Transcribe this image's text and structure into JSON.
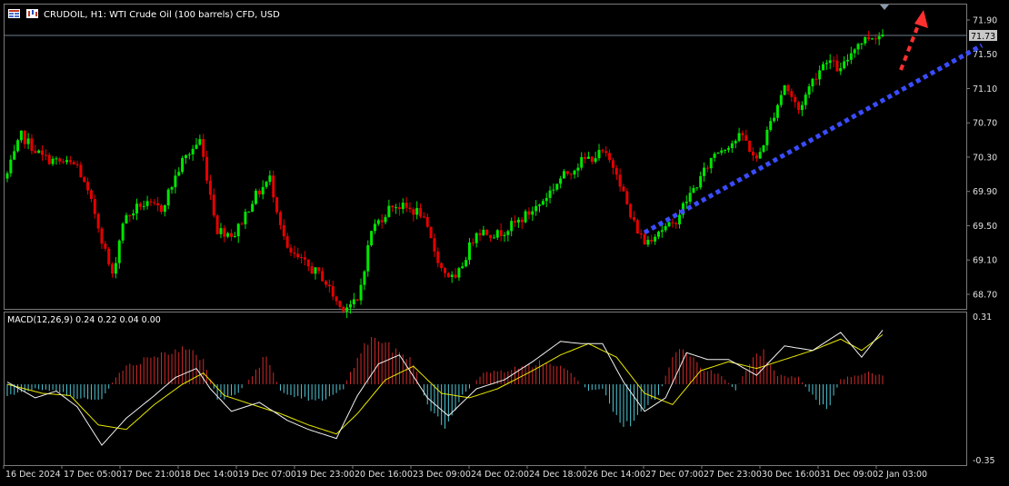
{
  "header": {
    "symbol_line": "CRUDOIL, H1:  WTI Crude Oil (100 barrels) CFD, USD"
  },
  "macd": {
    "label": "MACD(12,26,9) 0.24 0.22 0.04 0.00",
    "top_label": "0.31",
    "bottom_label": "-0.35"
  },
  "price_axis": {
    "ticks": [
      "71.90",
      "71.50",
      "71.10",
      "70.70",
      "70.30",
      "69.90",
      "69.50",
      "69.10",
      "68.70"
    ],
    "current_price_label": "71.73"
  },
  "time_axis": {
    "labels": [
      "16 Dec 2024",
      "17 Dec 05:00",
      "17 Dec 21:00",
      "18 Dec 14:00",
      "19 Dec 07:00",
      "19 Dec 23:00",
      "20 Dec 16:00",
      "23 Dec 09:00",
      "24 Dec 02:00",
      "24 Dec 18:00",
      "26 Dec 14:00",
      "27 Dec 07:00",
      "27 Dec 23:00",
      "30 Dec 16:00",
      "31 Dec 09:00",
      "2 Jan 03:00"
    ]
  },
  "colors": {
    "background": "#000000",
    "bull": "#00e600",
    "bear": "#e60000",
    "macd_pos": "#d02a2a",
    "macd_neg": "#4fc7d6",
    "macd_line": "#f2f2f2",
    "signal_line": "#e8e800",
    "trendline": "#3a4cff",
    "forecast_arrow": "#ff3030",
    "axis_text": "#e0e0e0",
    "frame": "#7a7a7a"
  },
  "icons": [
    "grid-icon",
    "chart-type-icon"
  ],
  "chart_data": [
    {
      "type": "candlestick",
      "axis": "right",
      "ylim": [
        68.53,
        72.08
      ],
      "grid": false,
      "anchors": [
        [
          0,
          70.1
        ],
        [
          4,
          70.55
        ],
        [
          10,
          70.3
        ],
        [
          14,
          70.25
        ],
        [
          20,
          70.2
        ],
        [
          25,
          69.65
        ],
        [
          30,
          68.9
        ],
        [
          33,
          69.55
        ],
        [
          38,
          69.75
        ],
        [
          44,
          69.7
        ],
        [
          50,
          70.25
        ],
        [
          55,
          70.5
        ],
        [
          60,
          69.45
        ],
        [
          65,
          69.4
        ],
        [
          70,
          69.8
        ],
        [
          75,
          70.05
        ],
        [
          80,
          69.2
        ],
        [
          85,
          69.05
        ],
        [
          90,
          68.9
        ],
        [
          95,
          68.55
        ],
        [
          100,
          68.6
        ],
        [
          104,
          69.45
        ],
        [
          110,
          69.75
        ],
        [
          118,
          69.65
        ],
        [
          124,
          69.0
        ],
        [
          128,
          68.85
        ],
        [
          134,
          69.45
        ],
        [
          140,
          69.4
        ],
        [
          146,
          69.55
        ],
        [
          152,
          69.75
        ],
        [
          158,
          70.05
        ],
        [
          164,
          70.25
        ],
        [
          170,
          70.35
        ],
        [
          174,
          70.15
        ],
        [
          178,
          69.6
        ],
        [
          182,
          69.3
        ],
        [
          186,
          69.45
        ],
        [
          190,
          69.5
        ],
        [
          194,
          69.8
        ],
        [
          198,
          70.05
        ],
        [
          202,
          70.35
        ],
        [
          206,
          70.45
        ],
        [
          210,
          70.55
        ],
        [
          214,
          70.25
        ],
        [
          218,
          70.7
        ],
        [
          222,
          71.15
        ],
        [
          226,
          70.85
        ],
        [
          230,
          71.2
        ],
        [
          234,
          71.45
        ],
        [
          238,
          71.3
        ],
        [
          242,
          71.6
        ],
        [
          246,
          71.7
        ],
        [
          250,
          71.73
        ]
      ]
    },
    {
      "type": "bar+line",
      "name": "MACD(12,26,9)",
      "ylim": [
        -0.35,
        0.31
      ],
      "histogram_anchors": [
        [
          0,
          -0.05
        ],
        [
          8,
          -0.02
        ],
        [
          14,
          -0.03
        ],
        [
          20,
          -0.06
        ],
        [
          27,
          -0.07
        ],
        [
          32,
          0.06
        ],
        [
          40,
          0.12
        ],
        [
          45,
          0.15
        ],
        [
          50,
          0.15
        ],
        [
          56,
          0.12
        ],
        [
          60,
          -0.07
        ],
        [
          66,
          -0.04
        ],
        [
          70,
          0.04
        ],
        [
          74,
          0.13
        ],
        [
          78,
          -0.03
        ],
        [
          84,
          -0.06
        ],
        [
          90,
          -0.07
        ],
        [
          96,
          -0.02
        ],
        [
          100,
          0.12
        ],
        [
          104,
          0.21
        ],
        [
          110,
          0.16
        ],
        [
          116,
          0.1
        ],
        [
          120,
          -0.1
        ],
        [
          125,
          -0.2
        ],
        [
          130,
          -0.05
        ],
        [
          136,
          0.05
        ],
        [
          142,
          0.06
        ],
        [
          148,
          0.08
        ],
        [
          154,
          0.1
        ],
        [
          160,
          0.06
        ],
        [
          166,
          -0.03
        ],
        [
          170,
          -0.02
        ],
        [
          174,
          -0.15
        ],
        [
          178,
          -0.2
        ],
        [
          182,
          -0.1
        ],
        [
          186,
          -0.05
        ],
        [
          190,
          0.12
        ],
        [
          194,
          0.16
        ],
        [
          198,
          0.07
        ],
        [
          204,
          0.04
        ],
        [
          208,
          -0.03
        ],
        [
          212,
          0.1
        ],
        [
          216,
          0.14
        ],
        [
          220,
          0.04
        ],
        [
          226,
          0.03
        ],
        [
          230,
          -0.05
        ],
        [
          234,
          -0.12
        ],
        [
          238,
          0.02
        ],
        [
          242,
          0.04
        ],
        [
          246,
          0.05
        ],
        [
          250,
          0.04
        ]
      ],
      "macd_anchors": [
        [
          0,
          0.01
        ],
        [
          8,
          -0.06
        ],
        [
          14,
          -0.03
        ],
        [
          20,
          -0.1
        ],
        [
          27,
          -0.27
        ],
        [
          34,
          -0.15
        ],
        [
          42,
          -0.05
        ],
        [
          48,
          0.03
        ],
        [
          54,
          0.07
        ],
        [
          58,
          -0.02
        ],
        [
          64,
          -0.12
        ],
        [
          72,
          -0.08
        ],
        [
          80,
          -0.16
        ],
        [
          86,
          -0.2
        ],
        [
          94,
          -0.24
        ],
        [
          100,
          -0.05
        ],
        [
          106,
          0.09
        ],
        [
          112,
          0.13
        ],
        [
          120,
          -0.06
        ],
        [
          126,
          -0.14
        ],
        [
          134,
          -0.02
        ],
        [
          142,
          0.02
        ],
        [
          150,
          0.1
        ],
        [
          158,
          0.19
        ],
        [
          164,
          0.18
        ],
        [
          170,
          0.18
        ],
        [
          176,
          0.01
        ],
        [
          182,
          -0.12
        ],
        [
          188,
          -0.06
        ],
        [
          194,
          0.14
        ],
        [
          200,
          0.11
        ],
        [
          206,
          0.11
        ],
        [
          214,
          0.04
        ],
        [
          222,
          0.17
        ],
        [
          230,
          0.15
        ],
        [
          238,
          0.23
        ],
        [
          244,
          0.12
        ],
        [
          250,
          0.24
        ]
      ],
      "signal_anchors": [
        [
          0,
          0.0
        ],
        [
          10,
          -0.04
        ],
        [
          18,
          -0.05
        ],
        [
          26,
          -0.18
        ],
        [
          34,
          -0.2
        ],
        [
          42,
          -0.09
        ],
        [
          50,
          0.0
        ],
        [
          56,
          0.05
        ],
        [
          62,
          -0.05
        ],
        [
          70,
          -0.09
        ],
        [
          78,
          -0.13
        ],
        [
          86,
          -0.18
        ],
        [
          94,
          -0.22
        ],
        [
          100,
          -0.13
        ],
        [
          108,
          0.02
        ],
        [
          116,
          0.08
        ],
        [
          124,
          -0.04
        ],
        [
          132,
          -0.06
        ],
        [
          140,
          -0.02
        ],
        [
          150,
          0.06
        ],
        [
          158,
          0.13
        ],
        [
          166,
          0.18
        ],
        [
          174,
          0.12
        ],
        [
          182,
          -0.04
        ],
        [
          190,
          -0.09
        ],
        [
          198,
          0.06
        ],
        [
          206,
          0.1
        ],
        [
          214,
          0.07
        ],
        [
          222,
          0.11
        ],
        [
          230,
          0.15
        ],
        [
          238,
          0.2
        ],
        [
          244,
          0.15
        ],
        [
          250,
          0.22
        ]
      ]
    }
  ]
}
